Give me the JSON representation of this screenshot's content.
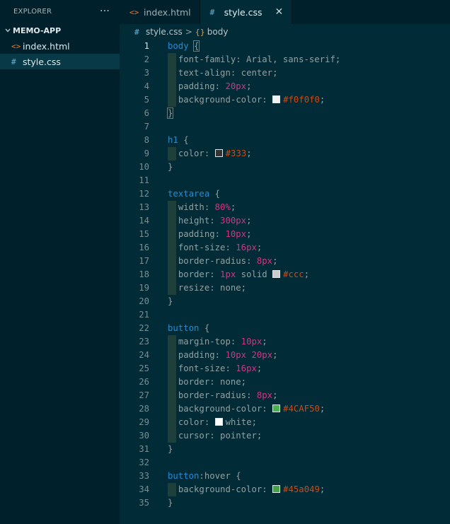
{
  "explorer": {
    "title": "EXPLORER",
    "more_label": "···",
    "folder": "MEMO-APP",
    "files": [
      {
        "name": "index.html",
        "icon": "<>",
        "type": "html",
        "active": false
      },
      {
        "name": "style.css",
        "icon": "#",
        "type": "css",
        "active": true
      }
    ]
  },
  "tabs": [
    {
      "label": "index.html",
      "icon": "<>",
      "active": false
    },
    {
      "label": "style.css",
      "icon": "#",
      "active": true,
      "close": "✕"
    }
  ],
  "breadcrumb": {
    "file": "style.css",
    "file_icon": "#",
    "separator": ">",
    "symbol_icon": "{}",
    "symbol": "body"
  },
  "editor": {
    "active_line": 1,
    "lines": [
      [
        {
          "t": "body",
          "c": "sel"
        },
        {
          "t": " "
        },
        {
          "t": "{",
          "c": "brace hl"
        }
      ],
      [
        {
          "t": "font-family",
          "c": "prop",
          "g": 1
        },
        {
          "t": ": Arial, sans-serif;",
          "c": "plain"
        }
      ],
      [
        {
          "t": "text-align",
          "c": "prop",
          "g": 1
        },
        {
          "t": ": center;",
          "c": "plain"
        }
      ],
      [
        {
          "t": "padding",
          "c": "prop",
          "g": 1
        },
        {
          "t": ": ",
          "c": "plain"
        },
        {
          "t": "20px",
          "c": "num"
        },
        {
          "t": ";",
          "c": "plain"
        }
      ],
      [
        {
          "t": "background-color",
          "c": "prop",
          "g": 1
        },
        {
          "t": ": ",
          "c": "plain"
        },
        {
          "sw": "#f0f0f0"
        },
        {
          "t": "#f0f0f0",
          "c": "hex"
        },
        {
          "t": ";",
          "c": "plain"
        }
      ],
      [
        {
          "t": "}",
          "c": "brace hl"
        }
      ],
      [],
      [
        {
          "t": "h1",
          "c": "sel"
        },
        {
          "t": " {",
          "c": "brace"
        }
      ],
      [
        {
          "t": "color",
          "c": "prop",
          "g": 1
        },
        {
          "t": ": ",
          "c": "plain"
        },
        {
          "sw": "#333333"
        },
        {
          "t": "#333",
          "c": "hex"
        },
        {
          "t": ";",
          "c": "plain"
        }
      ],
      [
        {
          "t": "}",
          "c": "brace"
        }
      ],
      [],
      [
        {
          "t": "textarea",
          "c": "sel"
        },
        {
          "t": " {",
          "c": "brace"
        }
      ],
      [
        {
          "t": "width",
          "c": "prop",
          "g": 1
        },
        {
          "t": ": ",
          "c": "plain"
        },
        {
          "t": "80%",
          "c": "num"
        },
        {
          "t": ";",
          "c": "plain"
        }
      ],
      [
        {
          "t": "height",
          "c": "prop",
          "g": 1
        },
        {
          "t": ": ",
          "c": "plain"
        },
        {
          "t": "300px",
          "c": "num"
        },
        {
          "t": ";",
          "c": "plain"
        }
      ],
      [
        {
          "t": "padding",
          "c": "prop",
          "g": 1
        },
        {
          "t": ": ",
          "c": "plain"
        },
        {
          "t": "10px",
          "c": "num"
        },
        {
          "t": ";",
          "c": "plain"
        }
      ],
      [
        {
          "t": "font-size",
          "c": "prop",
          "g": 1
        },
        {
          "t": ": ",
          "c": "plain"
        },
        {
          "t": "16px",
          "c": "num"
        },
        {
          "t": ";",
          "c": "plain"
        }
      ],
      [
        {
          "t": "border-radius",
          "c": "prop",
          "g": 1
        },
        {
          "t": ": ",
          "c": "plain"
        },
        {
          "t": "8px",
          "c": "num"
        },
        {
          "t": ";",
          "c": "plain"
        }
      ],
      [
        {
          "t": "border",
          "c": "prop",
          "g": 1
        },
        {
          "t": ": ",
          "c": "plain"
        },
        {
          "t": "1px",
          "c": "num"
        },
        {
          "t": " solid ",
          "c": "plain"
        },
        {
          "sw": "#cccccc"
        },
        {
          "t": "#ccc",
          "c": "hex"
        },
        {
          "t": ";",
          "c": "plain"
        }
      ],
      [
        {
          "t": "resize",
          "c": "prop",
          "g": 1
        },
        {
          "t": ": none;",
          "c": "plain"
        }
      ],
      [
        {
          "t": "}",
          "c": "brace"
        }
      ],
      [],
      [
        {
          "t": "button",
          "c": "sel"
        },
        {
          "t": " {",
          "c": "brace"
        }
      ],
      [
        {
          "t": "margin-top",
          "c": "prop",
          "g": 1
        },
        {
          "t": ": ",
          "c": "plain"
        },
        {
          "t": "10px",
          "c": "num"
        },
        {
          "t": ";",
          "c": "plain"
        }
      ],
      [
        {
          "t": "padding",
          "c": "prop",
          "g": 1
        },
        {
          "t": ": ",
          "c": "plain"
        },
        {
          "t": "10px",
          "c": "num"
        },
        {
          "t": " ",
          "c": "plain"
        },
        {
          "t": "20px",
          "c": "num"
        },
        {
          "t": ";",
          "c": "plain"
        }
      ],
      [
        {
          "t": "font-size",
          "c": "prop",
          "g": 1
        },
        {
          "t": ": ",
          "c": "plain"
        },
        {
          "t": "16px",
          "c": "num"
        },
        {
          "t": ";",
          "c": "plain"
        }
      ],
      [
        {
          "t": "border",
          "c": "prop",
          "g": 1
        },
        {
          "t": ": none;",
          "c": "plain"
        }
      ],
      [
        {
          "t": "border-radius",
          "c": "prop",
          "g": 1
        },
        {
          "t": ": ",
          "c": "plain"
        },
        {
          "t": "8px",
          "c": "num"
        },
        {
          "t": ";",
          "c": "plain"
        }
      ],
      [
        {
          "t": "background-color",
          "c": "prop",
          "g": 1
        },
        {
          "t": ": ",
          "c": "plain"
        },
        {
          "sw": "#4CAF50"
        },
        {
          "t": "#4CAF50",
          "c": "hex"
        },
        {
          "t": ";",
          "c": "plain"
        }
      ],
      [
        {
          "t": "color",
          "c": "prop",
          "g": 1
        },
        {
          "t": ": ",
          "c": "plain"
        },
        {
          "sw": "#ffffff"
        },
        {
          "t": "white;",
          "c": "plain"
        }
      ],
      [
        {
          "t": "cursor",
          "c": "prop",
          "g": 1
        },
        {
          "t": ": pointer;",
          "c": "plain"
        }
      ],
      [
        {
          "t": "}",
          "c": "brace"
        }
      ],
      [],
      [
        {
          "t": "button",
          "c": "sel"
        },
        {
          "t": ":hover {",
          "c": "plain"
        }
      ],
      [
        {
          "t": "background-color",
          "c": "prop",
          "g": 1
        },
        {
          "t": ": ",
          "c": "plain"
        },
        {
          "sw": "#45a049"
        },
        {
          "t": "#45a049",
          "c": "hex"
        },
        {
          "t": ";",
          "c": "plain"
        }
      ],
      [
        {
          "t": "}",
          "c": "brace"
        }
      ]
    ]
  }
}
